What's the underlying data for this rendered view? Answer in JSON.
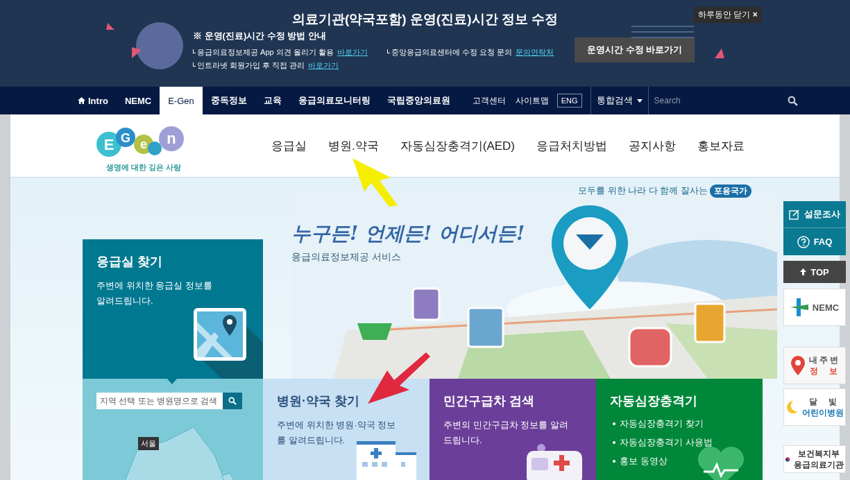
{
  "notice_banner": {
    "title": "의료기관(약국포함) 운영(진료)시간 정보 수정",
    "close_label": "하루동안 닫기",
    "close_mark": "×",
    "heading": "※ 운영(진료)시간 수정 방법 안내",
    "items": [
      {
        "text": "응급의료정보제공 App 의견 올리기 활용",
        "link": "바로가기"
      },
      {
        "text": "중앙응급의료센터에 수정 요청 문의",
        "link": "문의연락처"
      },
      {
        "text": "인트라넷 회원가입 후 직접 관리",
        "link": "바로가기"
      }
    ],
    "button": "운영시간 수정 바로가기"
  },
  "top_nav": {
    "items": [
      {
        "label": "Intro",
        "kind": "home",
        "selected": false
      },
      {
        "label": "NEMC",
        "kind": "plain",
        "selected": false
      },
      {
        "label": "E-Gen",
        "kind": "plain",
        "selected": true
      },
      {
        "label": "중독정보",
        "kind": "plain",
        "selected": false
      },
      {
        "label": "교육",
        "kind": "plain",
        "selected": false
      },
      {
        "label": "응급의료모니터링",
        "kind": "plain",
        "selected": false
      },
      {
        "label": "국립중앙의료원",
        "kind": "plain",
        "selected": false
      }
    ],
    "utility": [
      "고객센터",
      "사이트맵"
    ],
    "language": "ENG",
    "search_scope": "통합검색",
    "search_placeholder": "Search"
  },
  "logo": {
    "letters": [
      "E",
      "G",
      "e",
      "n"
    ],
    "tagline": "생명에 대한 깊은 사랑"
  },
  "main_menu": [
    "응급실",
    "병원.약국",
    "자동심장충격기(AED)",
    "응급처치방법",
    "공지사항",
    "홍보자료"
  ],
  "hero": {
    "slogan": "모두를 위한 나라 다 함께 잘사는",
    "slogan_badge": "포용국가",
    "headline": "누구든! 언제든! 어디서든!",
    "subheadline": "응급의료정보제공 서비스"
  },
  "cards": [
    {
      "kind": "emergency",
      "title": "응급실 찾기",
      "description": "주변에 위치한 응급실 정보를 알려드립니다."
    },
    {
      "kind": "hospital",
      "title": "병원·약국 찾기",
      "description": "주변에 위치한 병원·약국 정보를 알려드립니다."
    },
    {
      "kind": "ambulance",
      "title": "민간구급차 검색",
      "description": "주변의 민간구급차 정보를 알려드립니다."
    },
    {
      "kind": "aed",
      "title": "자동심장충격기",
      "bullets": [
        "자동심장충격기 찾기",
        "자동심장충격기 사용법",
        "홍보 동영상"
      ]
    }
  ],
  "region_search": {
    "placeholder": "지역 선택 또는 병원명으로 검색",
    "map_label": "서울"
  },
  "quick_menu": [
    {
      "kind": "survey",
      "lines": [
        "설문조사"
      ]
    },
    {
      "kind": "faq",
      "lines": [
        "FAQ"
      ]
    },
    {
      "kind": "top",
      "lines": [
        "TOP"
      ]
    },
    {
      "kind": "nemc",
      "lines": [
        "NEMC"
      ]
    },
    {
      "kind": "nearby",
      "lines": [
        "내 주 변",
        "정　 보"
      ]
    },
    {
      "kind": "moon",
      "lines": [
        "달　 빛",
        "어린이병원"
      ]
    },
    {
      "kind": "ministry",
      "lines": [
        "보건복지부",
        "응급의료기관"
      ]
    }
  ]
}
